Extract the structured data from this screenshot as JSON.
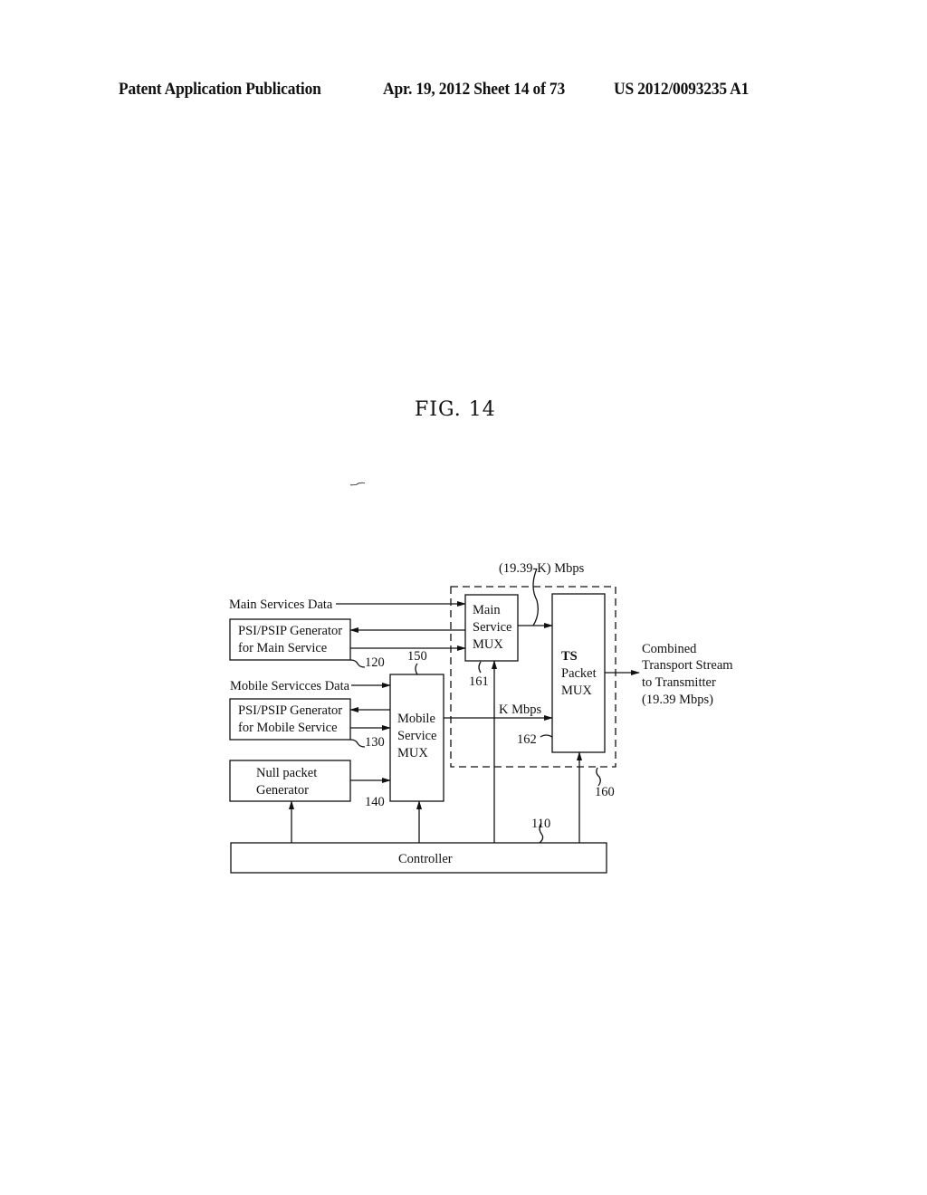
{
  "header": {
    "left": "Patent Application Publication",
    "center": "Apr. 19, 2012  Sheet 14 of 73",
    "right": "US 2012/0093235 A1"
  },
  "figure": {
    "title": "FIG. 14",
    "inputs": {
      "main_services_data": "Main Services Data",
      "mobile_services_data": "Mobile Servicces Data"
    },
    "blocks": {
      "psi_main": [
        "PSI/PSIP Generator",
        "for Main Service"
      ],
      "psi_mobile": [
        "PSI/PSIP Generator",
        "for Mobile Service"
      ],
      "null_packet": [
        "Null packet",
        "Generator"
      ],
      "mobile_mux": [
        "Mobile",
        "Service",
        "MUX"
      ],
      "main_mux": [
        "Main",
        "Service",
        "MUX"
      ],
      "ts_mux": [
        "TS",
        "Packet",
        "MUX"
      ],
      "controller": "Controller"
    },
    "labels": {
      "rate_main": "(19.39-K) Mbps",
      "rate_mobile": "K Mbps",
      "output": [
        "Combined",
        "Transport Stream",
        "to Transmitter",
        "(19.39 Mbps)"
      ]
    },
    "refs": {
      "controller": "110",
      "psi_main": "120",
      "psi_mobile": "130",
      "null_packet": "140",
      "mobile_mux": "150",
      "packet_mux_group": "160",
      "main_mux": "161",
      "ts_mux": "162"
    }
  }
}
